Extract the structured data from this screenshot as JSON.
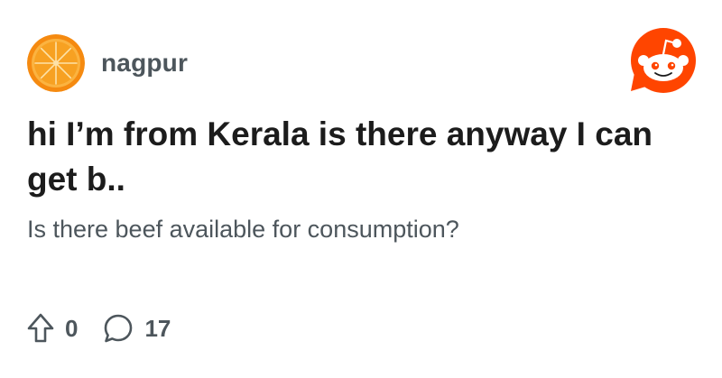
{
  "post": {
    "subreddit": "nagpur",
    "title": "hi I’m from Kerala is there anyway I can get b..",
    "body": "Is there beef available for consumption?",
    "upvotes": "0",
    "comments": "17"
  },
  "icons": {
    "subreddit_avatar": "orange-slice-icon",
    "brand_logo": "reddit-snoo-icon",
    "upvote": "upvote-arrow-icon",
    "comment": "comment-bubble-icon"
  },
  "colors": {
    "brand": "#ff4500",
    "orange": "#f58a10",
    "muted_text": "#4d565c",
    "title_text": "#1c1c1c"
  }
}
